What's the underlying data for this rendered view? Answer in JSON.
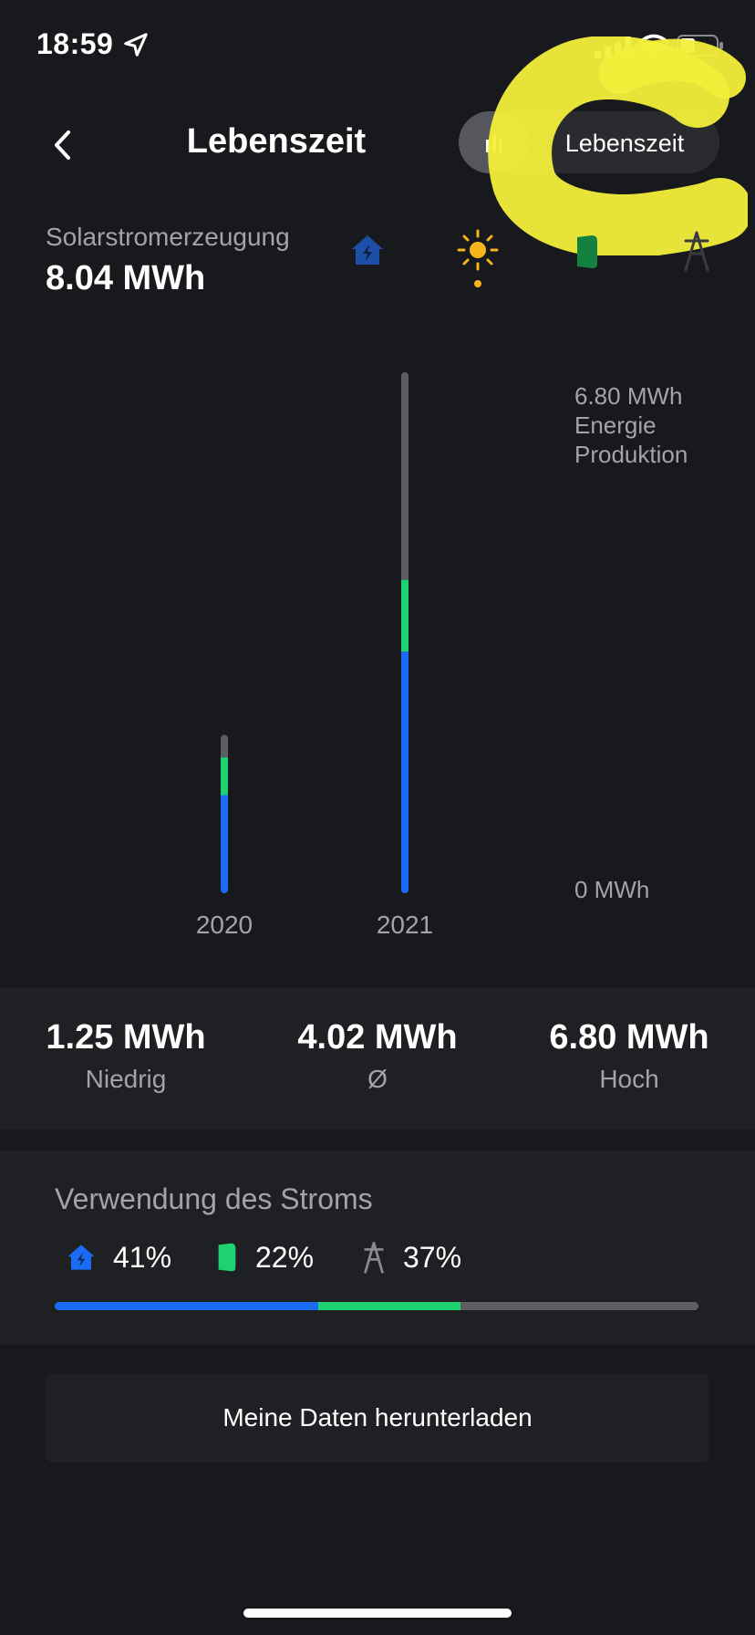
{
  "status_bar": {
    "time": "18:59"
  },
  "header": {
    "title": "Lebenszeit",
    "toggle_selected_label": "Lebenszeit"
  },
  "summary": {
    "label": "Solarstromerzeugung",
    "value": "8.04 MWh",
    "icons": [
      "home-icon",
      "sun-icon",
      "powerwall-icon",
      "grid-tower-icon"
    ],
    "selected_icon": "sun-icon"
  },
  "chart_data": {
    "type": "bar",
    "stacked": true,
    "categories": [
      "2020",
      "2021"
    ],
    "series": [
      {
        "color": "#1a6cf5",
        "values": [
          1.25,
          3.15
        ]
      },
      {
        "color": "#1fd26f",
        "values": [
          0.5,
          0.95
        ]
      },
      {
        "color": "#5d5e62",
        "values": [
          0.25,
          2.7
        ]
      }
    ],
    "ylim": [
      0,
      6.8
    ],
    "y_label_top": "6.80 MWh",
    "y_label_top_sub1": "Energie",
    "y_label_top_sub2": "Produktion",
    "y_label_bottom": "0 MWh",
    "grid": false
  },
  "stats": [
    {
      "value": "1.25 MWh",
      "label": "Niedrig"
    },
    {
      "value": "4.02 MWh",
      "label": "Ø"
    },
    {
      "value": "6.80 MWh",
      "label": "Hoch"
    }
  ],
  "usage": {
    "title": "Verwendung des Stroms",
    "items": [
      {
        "icon": "home-icon",
        "percent_label": "41%",
        "percent": 41,
        "color": "#1a6cf5"
      },
      {
        "icon": "powerwall-icon",
        "percent_label": "22%",
        "percent": 22,
        "color": "#1fd26f"
      },
      {
        "icon": "grid-tower-icon",
        "percent_label": "37%",
        "percent": 37,
        "color": "#5d5e62"
      }
    ]
  },
  "download_button": "Meine Daten herunterladen",
  "colors": {
    "background": "#18191c",
    "panel": "#1f2023",
    "accent_blue": "#1a6cf5",
    "accent_green": "#1fd26f",
    "accent_sun": "#f6b51d",
    "grey": "#5d5e62",
    "scribble": "#f2ee3a"
  }
}
